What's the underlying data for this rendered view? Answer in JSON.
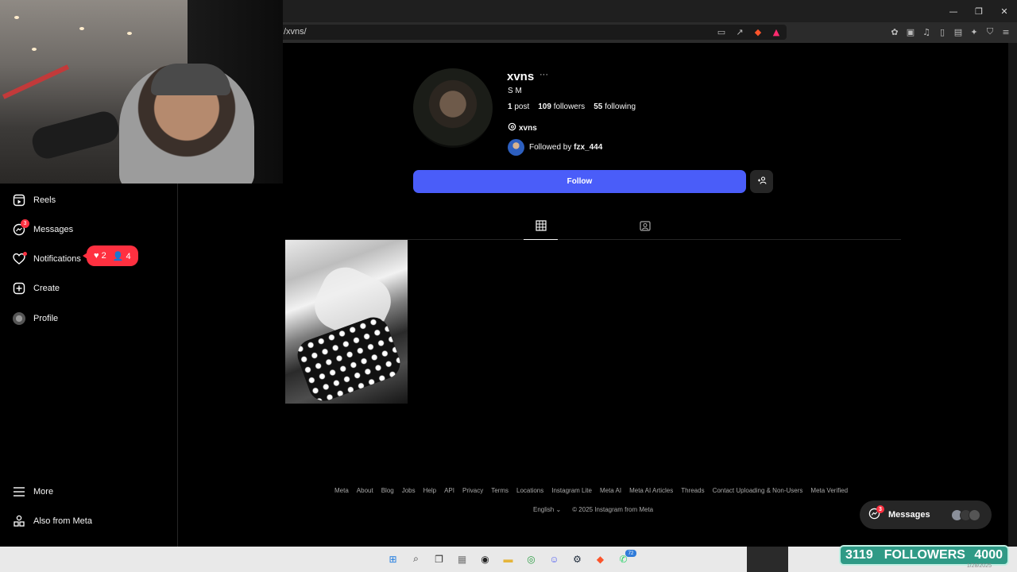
{
  "browser": {
    "url_text": "/xvns/",
    "window_controls": [
      "—",
      "❐",
      "✕"
    ]
  },
  "sidebar": {
    "items": [
      {
        "label": "Reels",
        "icon": "reels-icon"
      },
      {
        "label": "Messages",
        "icon": "messages-icon",
        "badge": "3"
      },
      {
        "label": "Notifications",
        "icon": "heart-icon"
      },
      {
        "label": "Create",
        "icon": "plus-square-icon"
      },
      {
        "label": "Profile",
        "icon": "profile-avatar-icon"
      },
      {
        "label": "More",
        "icon": "menu-icon"
      },
      {
        "label": "Also from Meta",
        "icon": "meta-apps-icon"
      }
    ],
    "notification_pill": {
      "likes": "2",
      "follows": "4"
    }
  },
  "profile": {
    "username": "xvns",
    "more": "···",
    "full_name": "S M",
    "posts_count": "1",
    "posts_label": "post",
    "followers_count": "109",
    "followers_label": "followers",
    "following_count": "55",
    "following_label": "following",
    "threads_handle": "xvns",
    "followed_by_prefix": "Followed by",
    "followed_by_user": "fzx_444",
    "follow_button": "Follow"
  },
  "footer": {
    "links": [
      "Meta",
      "About",
      "Blog",
      "Jobs",
      "Help",
      "API",
      "Privacy",
      "Terms",
      "Locations",
      "Instagram Lite",
      "Meta AI",
      "Meta AI Articles",
      "Threads",
      "Contact Uploading & Non-Users",
      "Meta Verified"
    ],
    "language": "English",
    "copyright": "© 2025 Instagram from Meta"
  },
  "messages_float": {
    "label": "Messages",
    "badge": "3"
  },
  "taskbar": {
    "badge": "72"
  },
  "follower_goal": {
    "current": "3119",
    "label": "FOLLOWERS",
    "target": "4000",
    "date": "1/28/2025"
  },
  "colors": {
    "follow_blue": "#4a5df9",
    "badge_red": "#ff3040",
    "goal_teal": "#2f9a86"
  }
}
